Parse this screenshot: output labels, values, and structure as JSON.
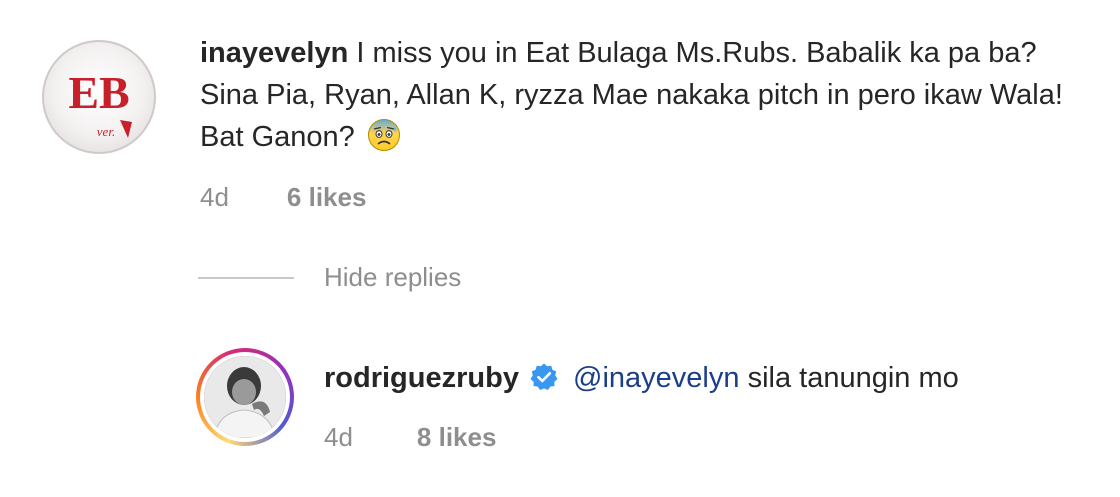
{
  "comment": {
    "username": "inayevelyn",
    "text": "I miss you in Eat Bulaga Ms.Rubs. Babalik ka pa ba? Sina Pia, Ryan, Allan K, ryzza Mae nakaka pitch in pero ikaw Wala! Bat Ganon?",
    "emoji": "anxious-face-emoji",
    "avatar": {
      "letters": "EB",
      "sub": "ver.4",
      "color": "#c8202a"
    },
    "time": "4d",
    "likes": "6 likes"
  },
  "replies_toggle": {
    "label": "Hide replies"
  },
  "reply": {
    "username": "rodriguezruby",
    "verified_icon": "verified-badge-icon",
    "verified_color": "#3897f0",
    "mention": "@inayevelyn",
    "text": "sila tanungin mo",
    "time": "4d",
    "likes": "8 likes"
  }
}
